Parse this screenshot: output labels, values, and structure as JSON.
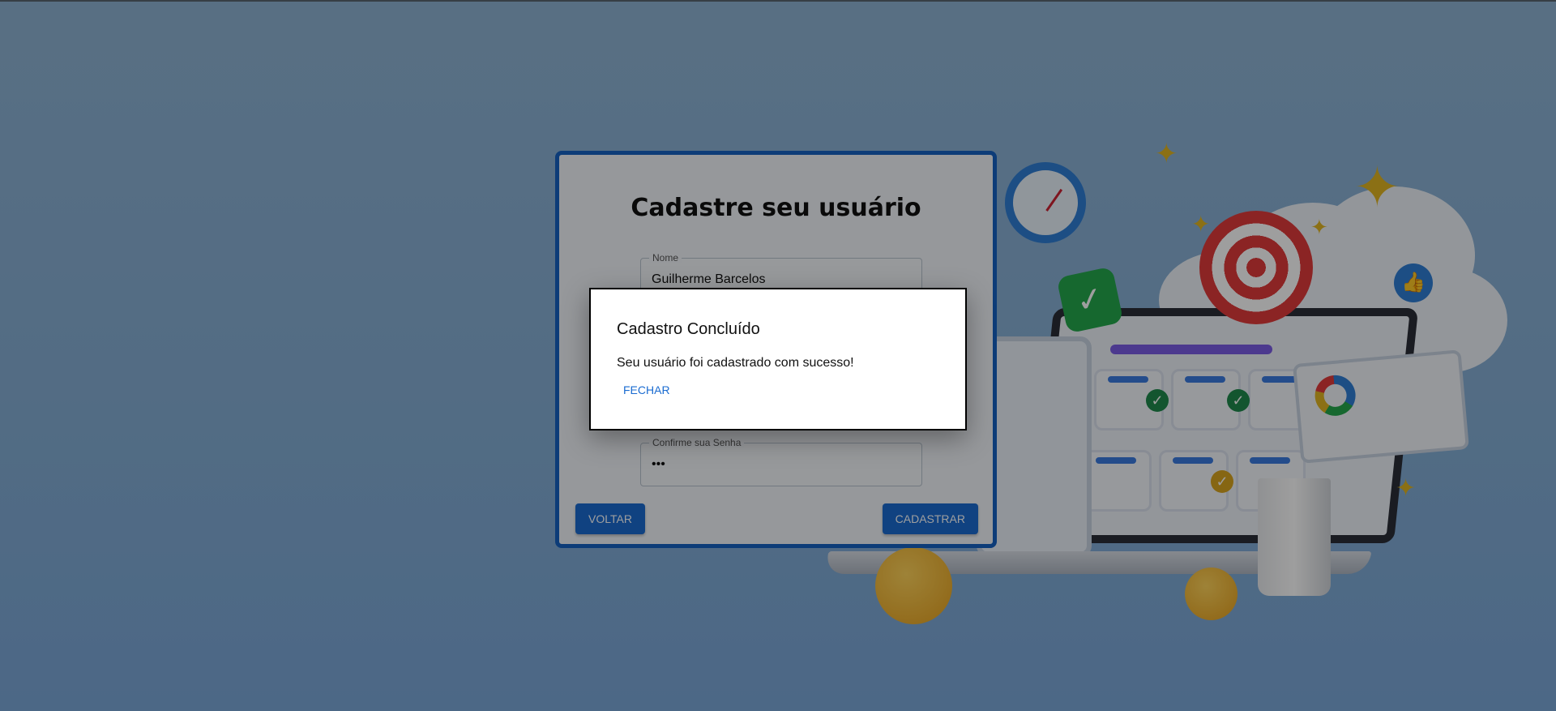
{
  "form": {
    "title": "Cadastre seu usuário",
    "fields": [
      {
        "label": "Nome",
        "value": "Guilherme Barcelos"
      },
      {
        "label": "Confirme sua Senha",
        "value": "•••"
      }
    ],
    "back_label": "VOLTAR",
    "submit_label": "CADASTRAR"
  },
  "dialog": {
    "title": "Cadastro Concluído",
    "message": "Seu usuário foi cadastrado com sucesso!",
    "close_label": "FECHAR"
  },
  "colors": {
    "primary": "#1a6bd1",
    "background": "#86afd6",
    "dialog_bg": "#ffffff"
  }
}
